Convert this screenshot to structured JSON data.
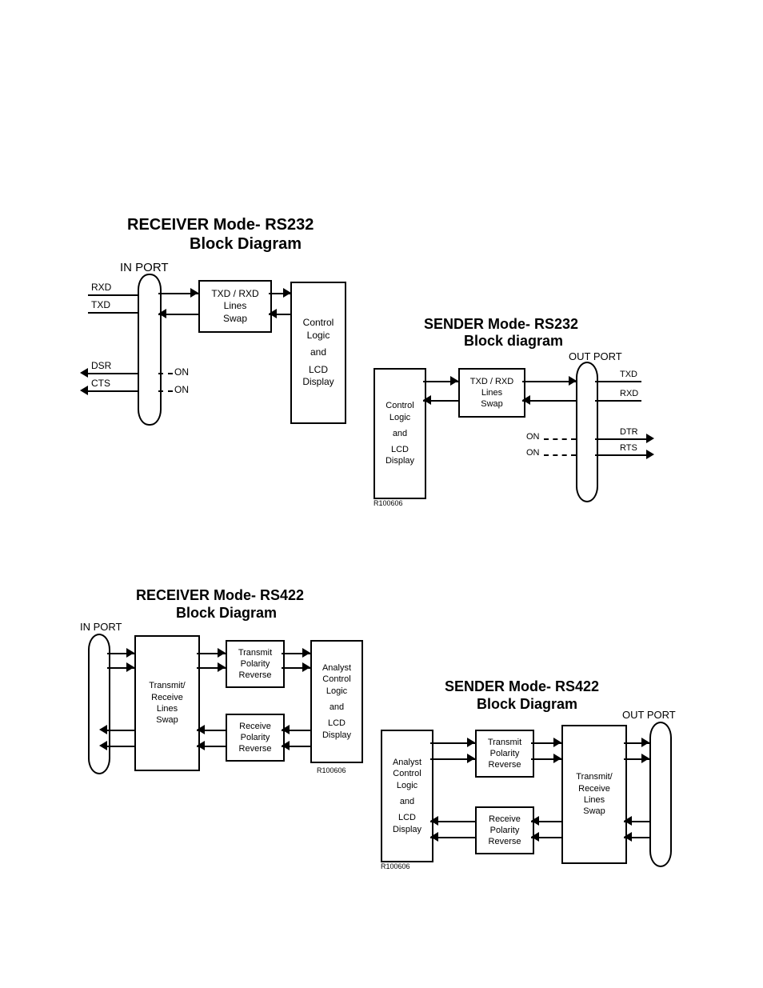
{
  "diagrams": {
    "receiver_rs232": {
      "title1": "RECEIVER Mode- RS232",
      "title2": "Block Diagram",
      "port_label": "IN PORT",
      "swap": {
        "l1": "TXD / RXD",
        "l2": "Lines",
        "l3": "Swap"
      },
      "ctrl": {
        "l1": "Control",
        "l2": "Logic",
        "l3": "and",
        "l4": "LCD",
        "l5": "Display"
      },
      "sig": {
        "rxd": "RXD",
        "txd": "TXD",
        "dsr": "DSR",
        "cts": "CTS",
        "on1": "ON",
        "on2": "ON"
      }
    },
    "sender_rs232": {
      "title1": "SENDER Mode- RS232",
      "title2": "Block diagram",
      "port_label": "OUT PORT",
      "swap": {
        "l1": "TXD / RXD",
        "l2": "Lines",
        "l3": "Swap"
      },
      "ctrl": {
        "l1": "Control",
        "l2": "Logic",
        "l3": "and",
        "l4": "LCD",
        "l5": "Display"
      },
      "sig": {
        "txd": "TXD",
        "rxd": "RXD",
        "dtr": "DTR",
        "rts": "RTS",
        "on1": "ON",
        "on2": "ON"
      },
      "rev": "R100606"
    },
    "receiver_rs422": {
      "title1": "RECEIVER Mode- RS422",
      "title2": "Block Diagram",
      "port_label": "IN PORT",
      "swap": {
        "l1": "Transmit/",
        "l2": "Receive",
        "l3": "Lines",
        "l4": "Swap"
      },
      "tx": {
        "l1": "Transmit",
        "l2": "Polarity",
        "l3": "Reverse"
      },
      "rx": {
        "l1": "Receive",
        "l2": "Polarity",
        "l3": "Reverse"
      },
      "ctrl": {
        "l1": "Analyst",
        "l2": "Control",
        "l3": "Logic",
        "l4": "and",
        "l5": "LCD",
        "l6": "Display"
      },
      "rev": "R100606"
    },
    "sender_rs422": {
      "title1": "SENDER Mode- RS422",
      "title2": "Block Diagram",
      "port_label": "OUT PORT",
      "swap": {
        "l1": "Transmit/",
        "l2": "Receive",
        "l3": "Lines",
        "l4": "Swap"
      },
      "tx": {
        "l1": "Transmit",
        "l2": "Polarity",
        "l3": "Reverse"
      },
      "rx": {
        "l1": "Receive",
        "l2": "Polarity",
        "l3": "Reverse"
      },
      "ctrl": {
        "l1": "Analyst",
        "l2": "Control",
        "l3": "Logic",
        "l4": "and",
        "l5": "LCD",
        "l6": "Display"
      },
      "rev": "R100606"
    }
  }
}
